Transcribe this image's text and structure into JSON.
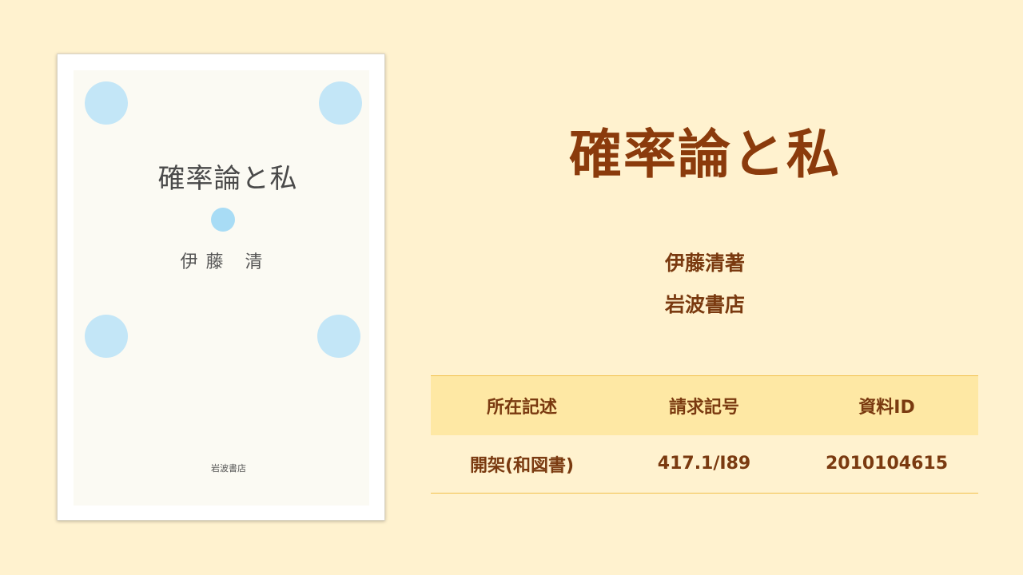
{
  "cover": {
    "title": "確率論と私",
    "author": "伊藤 清",
    "publisher": "岩波書店"
  },
  "book": {
    "title": "確率論と私",
    "author": "伊藤清著",
    "publisher": "岩波書店"
  },
  "holdings": {
    "headers": [
      "所在記述",
      "請求記号",
      "資料ID"
    ],
    "rows": [
      [
        "開架(和図書)",
        "417.1/I89",
        "2010104615"
      ]
    ]
  },
  "colors": {
    "background": "#fff2cf",
    "title": "#8b3b0c",
    "text": "#7a3a10",
    "header_bg": "#fee8a4",
    "rule": "#f2c14c",
    "dot": "#c3e6f7"
  }
}
